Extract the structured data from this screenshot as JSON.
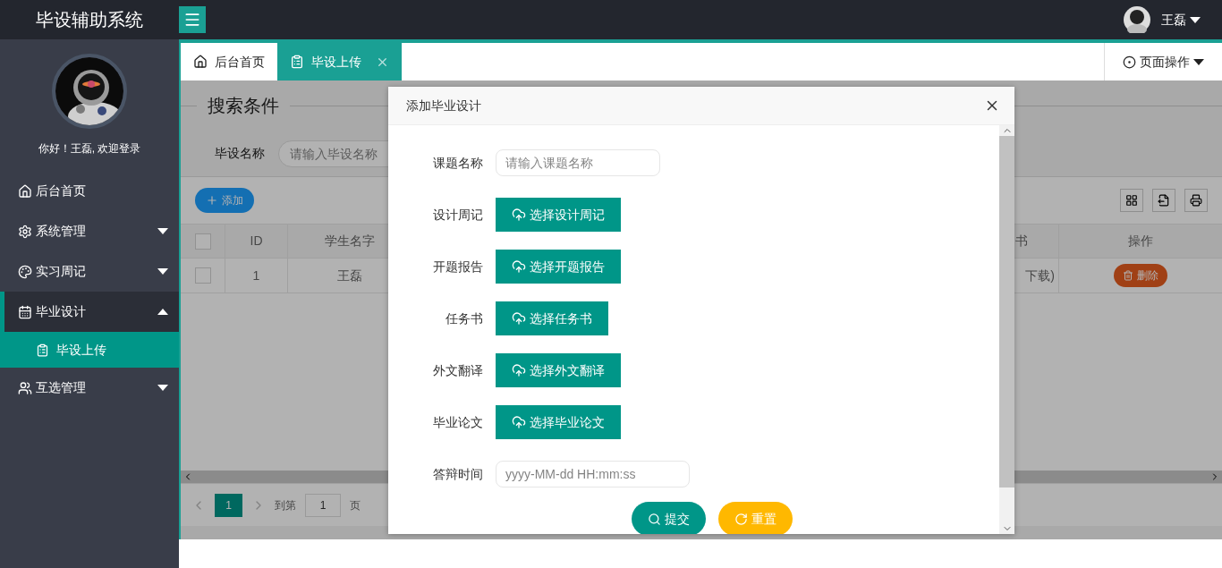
{
  "header": {
    "title": "毕设辅助系统",
    "user": "王磊"
  },
  "sidebar": {
    "greeting": "你好！王磊, 欢迎登录",
    "items": [
      {
        "kind": "home",
        "label": "后台首页",
        "selected": false
      },
      {
        "kind": "gear",
        "label": "系统管理",
        "selected": false,
        "expanded": false
      },
      {
        "kind": "palette",
        "label": "实习周记",
        "selected": false,
        "expanded": false
      },
      {
        "kind": "calendar",
        "label": "毕业设计",
        "selected": true,
        "expanded": true,
        "children": [
          {
            "label": "毕设上传",
            "selected": true
          }
        ]
      },
      {
        "kind": "users",
        "label": "互选管理",
        "selected": false,
        "expanded": false
      }
    ]
  },
  "tabs": [
    {
      "kind": "home",
      "label": "后台首页",
      "selected": false,
      "closable": false
    },
    {
      "kind": "clipboard",
      "label": "毕设上传",
      "selected": true,
      "closable": true
    }
  ],
  "page_actions": "页面操作",
  "search": {
    "title": "搜索条件",
    "label": "毕设名称",
    "placeholder": "请输入毕设名称"
  },
  "toolbar": {
    "add": "添加"
  },
  "table": {
    "columns": [
      "ID",
      "学生名字",
      "书",
      "操作"
    ],
    "rows": [
      {
        "checked": false,
        "cells": [
          "1",
          "王磊",
          "下载)"
        ],
        "action": "删除"
      }
    ],
    "header_checked": false
  },
  "pagination": {
    "page": "1",
    "goto_label": "到第",
    "goto_value": "1",
    "page_label": "页"
  },
  "dialog": {
    "title": "添加毕业设计",
    "fields": [
      {
        "kind": "input",
        "label": "课题名称",
        "placeholder": "请输入课题名称"
      },
      {
        "kind": "upload",
        "label": "设计周记",
        "button": "选择设计周记"
      },
      {
        "kind": "upload",
        "label": "开题报告",
        "button": "选择开题报告"
      },
      {
        "kind": "upload",
        "label": "任务书",
        "button": "选择任务书"
      },
      {
        "kind": "upload",
        "label": "外文翻译",
        "button": "选择外文翻译"
      },
      {
        "kind": "upload",
        "label": "毕业论文",
        "button": "选择毕业论文"
      },
      {
        "kind": "datetime",
        "label": "答辩时间",
        "placeholder": "yyyy-MM-dd HH:mm:ss"
      }
    ],
    "submit": "提交",
    "reset": "重置"
  }
}
